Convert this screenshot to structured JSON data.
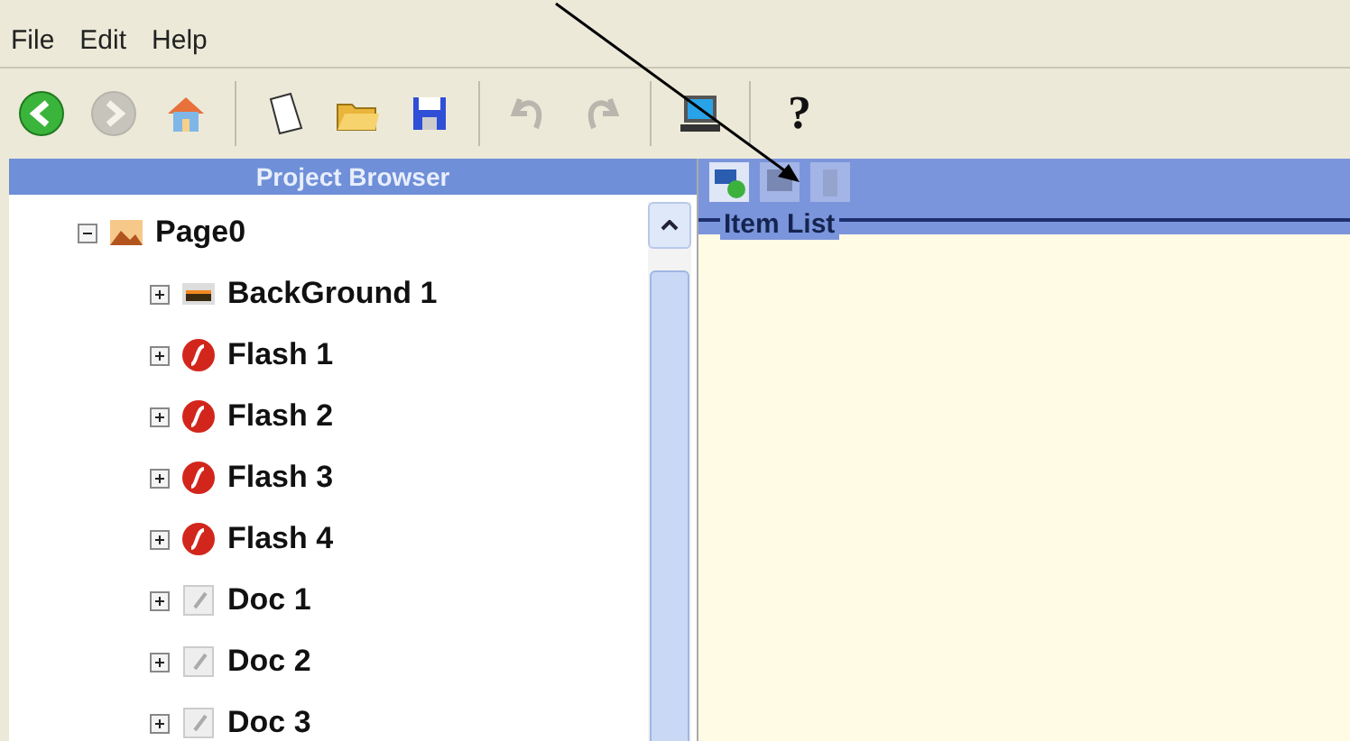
{
  "menu": [
    "File",
    "Edit",
    "Help"
  ],
  "toolbar": [
    {
      "kind": "back",
      "disabled": false
    },
    {
      "kind": "forward",
      "disabled": true
    },
    {
      "kind": "home",
      "disabled": false
    },
    {
      "kind": "sep"
    },
    {
      "kind": "new",
      "disabled": false
    },
    {
      "kind": "open",
      "disabled": false
    },
    {
      "kind": "save",
      "disabled": false
    },
    {
      "kind": "sep"
    },
    {
      "kind": "undo",
      "disabled": true
    },
    {
      "kind": "redo",
      "disabled": true
    },
    {
      "kind": "sep"
    },
    {
      "kind": "monitor",
      "disabled": false
    },
    {
      "kind": "sep"
    },
    {
      "kind": "help",
      "disabled": false,
      "label": "?"
    }
  ],
  "project_browser": {
    "title": "Project Browser",
    "tree": [
      {
        "label": "Page0",
        "kind": "page",
        "expanded": true,
        "children": [
          {
            "label": "BackGround 1",
            "kind": "image",
            "expanded": false
          },
          {
            "label": "Flash 1",
            "kind": "flash",
            "expanded": false
          },
          {
            "label": "Flash 2",
            "kind": "flash",
            "expanded": false
          },
          {
            "label": "Flash 3",
            "kind": "flash",
            "expanded": false
          },
          {
            "label": "Flash 4",
            "kind": "flash",
            "expanded": false
          },
          {
            "label": "Doc 1",
            "kind": "doc",
            "expanded": false
          },
          {
            "label": "Doc 2",
            "kind": "doc",
            "expanded": false
          },
          {
            "label": "Doc 3",
            "kind": "doc",
            "expanded": false
          }
        ]
      }
    ]
  },
  "item_panel": {
    "tools": [
      {
        "kind": "add",
        "disabled": false
      },
      {
        "kind": "edit",
        "disabled": true
      },
      {
        "kind": "delete",
        "disabled": true
      }
    ],
    "group_title": "Item List"
  }
}
